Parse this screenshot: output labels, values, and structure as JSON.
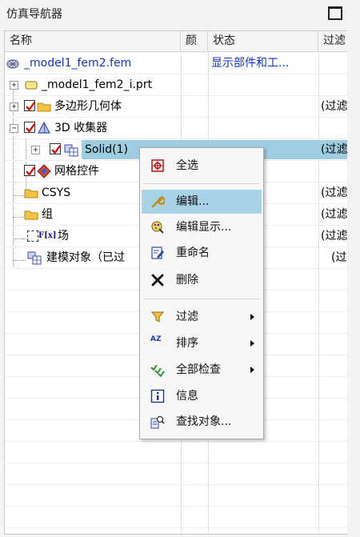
{
  "panel": {
    "title": "仿真导航器"
  },
  "columns": [
    "名称",
    "颜",
    "状态",
    "过滤"
  ],
  "rows": [
    {
      "name": "_model1_fem2.fem",
      "status": "显示部件和工...",
      "filter": "",
      "blue": true
    },
    {
      "name": "_model1_fem2_i.prt",
      "status": "",
      "filter": ""
    },
    {
      "name": "多边形几何体",
      "status": "",
      "filter": "(过滤"
    },
    {
      "name": "3D 收集器",
      "status": "",
      "filter": ""
    },
    {
      "name": "Solid(1)",
      "status": "",
      "filter": "(过滤"
    },
    {
      "name": "网格控件",
      "status": "",
      "filter": ""
    },
    {
      "name": "CSYS",
      "status": "",
      "filter": "(过滤"
    },
    {
      "name": "组",
      "status": "",
      "filter": "(过滤"
    },
    {
      "name": "场",
      "status": "",
      "filter": "(过滤"
    },
    {
      "name": "建模对象（已过",
      "status": "",
      "filter": "(过"
    }
  ],
  "field_icon_text": "F[x]",
  "context_menu": {
    "items": [
      {
        "label": "全选",
        "icon": "select-all-icon"
      },
      {
        "label": "编辑...",
        "icon": "wrench-icon"
      },
      {
        "label": "编辑显示...",
        "icon": "edit-display-icon"
      },
      {
        "label": "重命名",
        "icon": "rename-icon"
      },
      {
        "label": "删除",
        "icon": "delete-x-icon"
      },
      {
        "label": "过滤",
        "icon": "filter-funnel-icon"
      },
      {
        "label": "排序",
        "icon": "sort-az-icon"
      },
      {
        "label": "全部检查",
        "icon": "check-all-icon"
      },
      {
        "label": "信息",
        "icon": "info-icon"
      },
      {
        "label": "查找对象...",
        "icon": "find-object-icon"
      }
    ],
    "sort_icon_text": "AZ"
  },
  "colors": {
    "selection": "#9fcde0",
    "menu_highlight": "#a8d3e6",
    "link_blue": "#1034c8",
    "check_red": "#e00000",
    "folder_yellow": "#f6c342"
  }
}
